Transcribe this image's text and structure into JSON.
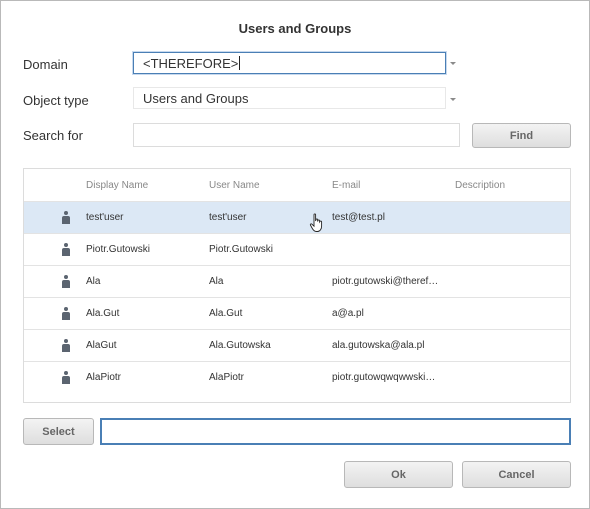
{
  "dialog": {
    "title": "Users and Groups"
  },
  "form": {
    "domain_label": "Domain",
    "domain_value": "<THEREFORE>",
    "object_type_label": "Object type",
    "object_type_value": "Users and Groups",
    "search_label": "Search for",
    "search_value": "",
    "find_label": "Find"
  },
  "grid": {
    "columns": [
      "Display Name",
      "User Name",
      "E-mail",
      "Description"
    ],
    "rows": [
      {
        "display_name": "test'user",
        "user_name": "test'user",
        "email": "test@test.pl",
        "description": "",
        "selected": true
      },
      {
        "display_name": "Piotr.Gutowski",
        "user_name": "Piotr.Gutowski",
        "email": "",
        "description": ""
      },
      {
        "display_name": "Ala",
        "user_name": "Ala",
        "email": "piotr.gutowski@theref…",
        "description": ""
      },
      {
        "display_name": "Ala.Gut",
        "user_name": "Ala.Gut",
        "email": "a@a.pl",
        "description": ""
      },
      {
        "display_name": "AlaGut",
        "user_name": "Ala.Gutowska",
        "email": "ala.gutowska@ala.pl",
        "description": ""
      },
      {
        "display_name": "AlaPiotr",
        "user_name": "AlaPiotr",
        "email": "piotr.gutowqwqwwski…",
        "description": ""
      }
    ]
  },
  "footer": {
    "select_label": "Select",
    "select_value": "",
    "ok_label": "Ok",
    "cancel_label": "Cancel"
  },
  "colors": {
    "focus_border": "#4a7fb5",
    "selected_row": "#dce8f5"
  }
}
